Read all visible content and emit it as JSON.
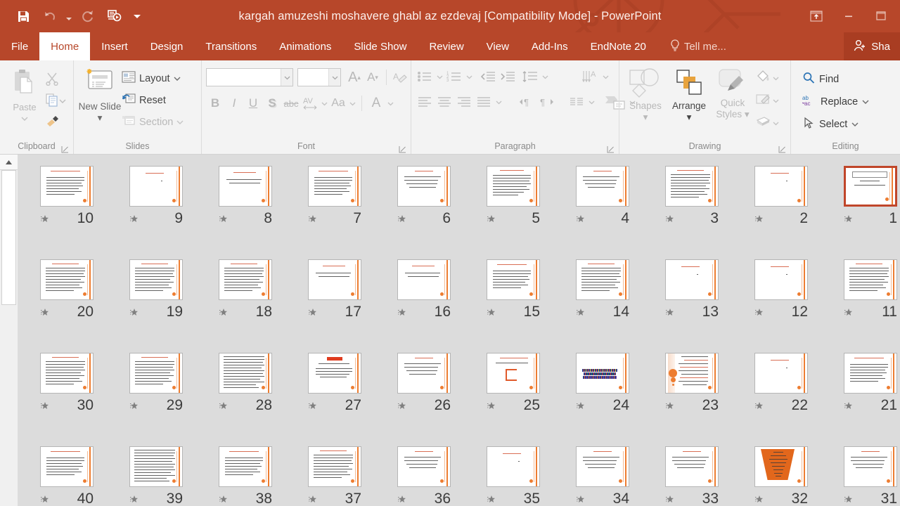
{
  "window": {
    "title": "kargah amuzeshi moshavere ghabl az ezdevaj [Compatibility Mode] - PowerPoint",
    "accent_color": "#b7472a",
    "controls": [
      {
        "name": "ribbon-display-options",
        "label": "Ribbon Display Options"
      },
      {
        "name": "minimize",
        "label": "Minimize"
      },
      {
        "name": "restore",
        "label": "Restore Down"
      }
    ]
  },
  "quick_access": [
    {
      "name": "save",
      "label": "Save",
      "icon": "save-icon"
    },
    {
      "name": "undo",
      "label": "Undo",
      "icon": "undo-icon",
      "disabled": true
    },
    {
      "name": "redo",
      "label": "Repeat",
      "icon": "redo-icon",
      "disabled": true
    },
    {
      "name": "start-from-beginning",
      "label": "Start From Beginning",
      "icon": "slideshow-icon"
    },
    {
      "name": "customize-qat",
      "label": "Customize Quick Access Toolbar",
      "icon": "chevron-down-icon"
    }
  ],
  "tabs": [
    {
      "label": "File",
      "active": false
    },
    {
      "label": "Home",
      "active": true
    },
    {
      "label": "Insert",
      "active": false
    },
    {
      "label": "Design",
      "active": false
    },
    {
      "label": "Transitions",
      "active": false
    },
    {
      "label": "Animations",
      "active": false
    },
    {
      "label": "Slide Show",
      "active": false
    },
    {
      "label": "Review",
      "active": false
    },
    {
      "label": "View",
      "active": false
    },
    {
      "label": "Add-Ins",
      "active": false
    },
    {
      "label": "EndNote 20",
      "active": false
    }
  ],
  "tell_me": {
    "label": "Tell me...",
    "icon": "lightbulb-icon"
  },
  "share": {
    "label": "Sha",
    "full_label": "Share",
    "icon": "person-add-icon"
  },
  "ribbon": {
    "groups": [
      {
        "name": "clipboard",
        "label": "Clipboard",
        "has_dialog_launcher": true,
        "commands": [
          {
            "name": "paste",
            "label": "Paste",
            "icon": "clipboard-icon",
            "disabled": true
          },
          {
            "name": "cut",
            "label": "Cut",
            "icon": "scissors-icon",
            "disabled": true
          },
          {
            "name": "copy",
            "label": "Copy",
            "icon": "copy-icon",
            "disabled": true
          },
          {
            "name": "format-painter",
            "label": "Format Painter",
            "icon": "paintbrush-icon",
            "disabled": true
          }
        ]
      },
      {
        "name": "slides",
        "label": "Slides",
        "has_dialog_launcher": false,
        "commands": [
          {
            "name": "new-slide",
            "label": "New Slide",
            "icon": "new-slide-icon",
            "disabled": false
          },
          {
            "name": "layout",
            "label": "Layout",
            "icon": "layout-icon",
            "disabled": false
          },
          {
            "name": "reset",
            "label": "Reset",
            "icon": "reset-icon",
            "disabled": false
          },
          {
            "name": "section",
            "label": "Section",
            "icon": "section-icon",
            "disabled": true
          }
        ]
      },
      {
        "name": "font",
        "label": "Font",
        "has_dialog_launcher": true,
        "font_name_value": "",
        "font_size_value": "",
        "commands": [
          {
            "name": "increase-font-size",
            "label": "A",
            "icon": "increase-font-icon",
            "disabled": true
          },
          {
            "name": "decrease-font-size",
            "label": "A",
            "icon": "decrease-font-icon",
            "disabled": true
          },
          {
            "name": "clear-formatting",
            "label": "Clear All Formatting",
            "icon": "clear-format-icon",
            "disabled": true
          },
          {
            "name": "bold",
            "label": "B",
            "icon": "bold-icon",
            "disabled": true
          },
          {
            "name": "italic",
            "label": "I",
            "icon": "italic-icon",
            "disabled": true
          },
          {
            "name": "underline",
            "label": "U",
            "icon": "underline-icon",
            "disabled": true
          },
          {
            "name": "text-shadow",
            "label": "S",
            "icon": "text-shadow-icon",
            "disabled": true
          },
          {
            "name": "strikethrough",
            "label": "abc",
            "icon": "strikethrough-icon",
            "disabled": true
          },
          {
            "name": "character-spacing",
            "label": "AV",
            "icon": "character-spacing-icon",
            "disabled": true
          },
          {
            "name": "change-case",
            "label": "Aa",
            "icon": "change-case-icon",
            "disabled": true
          },
          {
            "name": "font-color",
            "label": "A",
            "icon": "font-color-icon",
            "disabled": true
          }
        ]
      },
      {
        "name": "paragraph",
        "label": "Paragraph",
        "has_dialog_launcher": true,
        "commands": [
          {
            "name": "bullets",
            "label": "Bullets",
            "icon": "bullet-list-icon",
            "disabled": true
          },
          {
            "name": "numbering",
            "label": "Numbering",
            "icon": "numbered-list-icon",
            "disabled": true
          },
          {
            "name": "decrease-indent",
            "label": "Decrease List Level",
            "icon": "decrease-indent-icon",
            "disabled": true
          },
          {
            "name": "increase-indent",
            "label": "Increase List Level",
            "icon": "increase-indent-icon",
            "disabled": true
          },
          {
            "name": "line-spacing",
            "label": "Line Spacing",
            "icon": "line-spacing-icon",
            "disabled": true
          },
          {
            "name": "text-direction",
            "label": "Text Direction",
            "icon": "text-direction-icon",
            "disabled": true
          },
          {
            "name": "align-text",
            "label": "Align Text",
            "icon": "align-text-icon",
            "disabled": true
          },
          {
            "name": "align-left",
            "label": "Align Left",
            "icon": "align-left-icon",
            "disabled": true
          },
          {
            "name": "center",
            "label": "Center",
            "icon": "align-center-icon",
            "disabled": true
          },
          {
            "name": "align-right",
            "label": "Align Right",
            "icon": "align-right-icon",
            "disabled": true
          },
          {
            "name": "justify",
            "label": "Justify",
            "icon": "justify-icon",
            "disabled": true
          },
          {
            "name": "ltr",
            "label": "Left-to-Right",
            "icon": "ltr-icon",
            "disabled": true
          },
          {
            "name": "rtl",
            "label": "Right-to-Left",
            "icon": "rtl-icon",
            "disabled": true
          },
          {
            "name": "columns",
            "label": "Columns",
            "icon": "columns-icon",
            "disabled": true
          },
          {
            "name": "convert-to-smartart",
            "label": "Convert to SmartArt",
            "icon": "smartart-icon",
            "disabled": true
          }
        ]
      },
      {
        "name": "drawing",
        "label": "Drawing",
        "has_dialog_launcher": true,
        "commands": [
          {
            "name": "shapes",
            "label": "Shapes",
            "icon": "shapes-icon",
            "disabled": true
          },
          {
            "name": "arrange",
            "label": "Arrange",
            "icon": "arrange-icon",
            "disabled": false
          },
          {
            "name": "quick-styles",
            "label": "Quick Styles",
            "icon": "quick-styles-icon",
            "disabled": true
          },
          {
            "name": "shape-fill",
            "label": "Shape Fill",
            "icon": "fill-bucket-icon",
            "disabled": true
          },
          {
            "name": "shape-outline",
            "label": "Shape Outline",
            "icon": "pencil-outline-icon",
            "disabled": true
          },
          {
            "name": "shape-effects",
            "label": "Shape Effects",
            "icon": "shape-effects-icon",
            "disabled": true
          }
        ]
      },
      {
        "name": "editing",
        "label": "Editing",
        "has_dialog_launcher": false,
        "commands": [
          {
            "name": "find",
            "label": "Find",
            "icon": "search-icon",
            "disabled": false
          },
          {
            "name": "replace",
            "label": "Replace",
            "icon": "replace-icon",
            "disabled": false
          },
          {
            "name": "select",
            "label": "Select",
            "icon": "cursor-icon",
            "disabled": false
          }
        ]
      }
    ]
  },
  "slide_sorter": {
    "scrollbar": {
      "up_arrow": "scroll-up-arrow",
      "thumb": "scroll-thumb"
    },
    "columns": 10,
    "rows": [
      {
        "slides": [
          10,
          9,
          8,
          7,
          6,
          5,
          4,
          3,
          2,
          1
        ]
      },
      {
        "slides": [
          20,
          19,
          18,
          17,
          16,
          15,
          14,
          13,
          12,
          11
        ]
      },
      {
        "slides": [
          30,
          29,
          28,
          27,
          26,
          25,
          24,
          23,
          22,
          21
        ]
      },
      {
        "slides": [
          40,
          39,
          38,
          37,
          36,
          35,
          34,
          33,
          32,
          31
        ]
      }
    ],
    "selected_slide": 1,
    "animation_badge_icon": "star-icon",
    "slides": {
      "1": {
        "kind": "title",
        "label": "1"
      },
      "2": {
        "kind": "text-sparse",
        "label": "2"
      },
      "3": {
        "kind": "text-dense",
        "label": "3"
      },
      "4": {
        "kind": "text-medium",
        "label": "4"
      },
      "5": {
        "kind": "text-lines",
        "label": "5"
      },
      "6": {
        "kind": "text-medium",
        "label": "6"
      },
      "7": {
        "kind": "text-heading-red",
        "label": "7"
      },
      "8": {
        "kind": "text-two-lines",
        "label": "8"
      },
      "9": {
        "kind": "text-sparse",
        "label": "9"
      },
      "10": {
        "kind": "text-heading-red",
        "label": "10"
      },
      "11": {
        "kind": "text-dense",
        "label": "11"
      },
      "12": {
        "kind": "text-sparse",
        "label": "12"
      },
      "13": {
        "kind": "text-sparse",
        "label": "13"
      },
      "14": {
        "kind": "text-dense",
        "label": "14"
      },
      "15": {
        "kind": "text-heading-red",
        "label": "15"
      },
      "16": {
        "kind": "text-two-lines",
        "label": "16"
      },
      "17": {
        "kind": "text-two-lines",
        "label": "17"
      },
      "18": {
        "kind": "text-dense",
        "label": "18"
      },
      "19": {
        "kind": "text-dense",
        "label": "19"
      },
      "20": {
        "kind": "text-dense",
        "label": "20"
      },
      "21": {
        "kind": "text-heading-red",
        "label": "21"
      },
      "22": {
        "kind": "text-sparse",
        "label": "22"
      },
      "23": {
        "kind": "orange-circles",
        "label": "23"
      },
      "24": {
        "kind": "color-blocks",
        "label": "24"
      },
      "25": {
        "kind": "diagram",
        "label": "25"
      },
      "26": {
        "kind": "text-medium",
        "label": "26"
      },
      "27": {
        "kind": "red-header-block",
        "label": "27"
      },
      "28": {
        "kind": "text-very-dense",
        "label": "28"
      },
      "29": {
        "kind": "text-dense",
        "label": "29"
      },
      "30": {
        "kind": "text-dense",
        "label": "30"
      },
      "31": {
        "kind": "text-medium",
        "label": "31"
      },
      "32": {
        "kind": "orange-funnel",
        "label": "32"
      },
      "33": {
        "kind": "text-medium",
        "label": "33"
      },
      "34": {
        "kind": "text-medium",
        "label": "34"
      },
      "35": {
        "kind": "text-sparse",
        "label": "35"
      },
      "36": {
        "kind": "text-medium",
        "label": "36"
      },
      "37": {
        "kind": "text-dense",
        "label": "37"
      },
      "38": {
        "kind": "text-heading-red",
        "label": "38"
      },
      "39": {
        "kind": "text-very-dense",
        "label": "39"
      },
      "40": {
        "kind": "text-heading-red",
        "label": "40"
      }
    }
  }
}
